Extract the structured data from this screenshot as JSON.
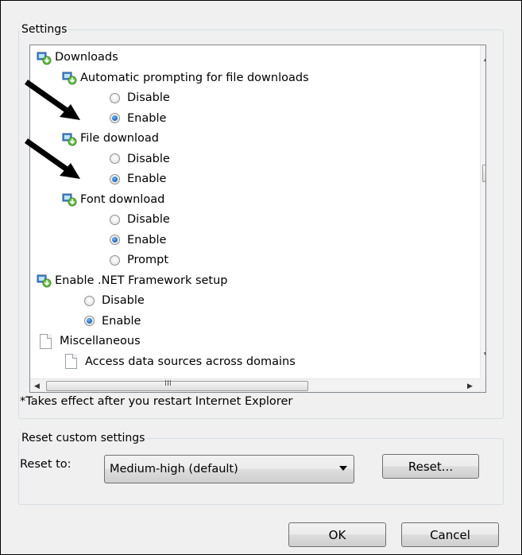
{
  "settings": {
    "group_title": "Settings",
    "tree": [
      {
        "kind": "folder",
        "label": "Downloads",
        "level": 0,
        "icon": "security-settings-icon"
      },
      {
        "kind": "folder",
        "label": "Automatic prompting for file downloads",
        "level": 1,
        "icon": "security-settings-icon"
      },
      {
        "kind": "radio",
        "label": "Disable",
        "level": 2,
        "selected": false
      },
      {
        "kind": "radio",
        "label": "Enable",
        "level": 2,
        "selected": true
      },
      {
        "kind": "folder",
        "label": "File download",
        "level": 1,
        "icon": "security-settings-icon"
      },
      {
        "kind": "radio",
        "label": "Disable",
        "level": 2,
        "selected": false
      },
      {
        "kind": "radio",
        "label": "Enable",
        "level": 2,
        "selected": true
      },
      {
        "kind": "folder",
        "label": "Font download",
        "level": 1,
        "icon": "security-settings-icon"
      },
      {
        "kind": "radio",
        "label": "Disable",
        "level": 2,
        "selected": false
      },
      {
        "kind": "radio",
        "label": "Enable",
        "level": 2,
        "selected": true
      },
      {
        "kind": "radio",
        "label": "Prompt",
        "level": 2,
        "selected": false
      },
      {
        "kind": "folder",
        "label": "Enable .NET Framework setup",
        "level": 0,
        "icon": "security-settings-icon"
      },
      {
        "kind": "radio",
        "label": "Disable",
        "level": 1,
        "selected": false
      },
      {
        "kind": "radio",
        "label": "Enable",
        "level": 1,
        "selected": true
      },
      {
        "kind": "doc",
        "label": "Miscellaneous",
        "level": 0,
        "icon": "document-icon"
      },
      {
        "kind": "doc",
        "label": "Access data sources across domains",
        "level": 1,
        "icon": "document-icon"
      }
    ],
    "scroll_arrows": {
      "up": "▲",
      "down": "▼",
      "left": "◀",
      "right": "▶",
      "grip": "III"
    },
    "note": "*Takes effect after you restart Internet Explorer"
  },
  "reset": {
    "group_title": "Reset custom settings",
    "label": "Reset to:",
    "selected_value": "Medium-high (default)",
    "button": "Reset..."
  },
  "footer": {
    "ok": "OK",
    "cancel": "Cancel"
  },
  "accent": {
    "radio_selected": "#1f64b4",
    "callout_arrow": "#000000"
  }
}
